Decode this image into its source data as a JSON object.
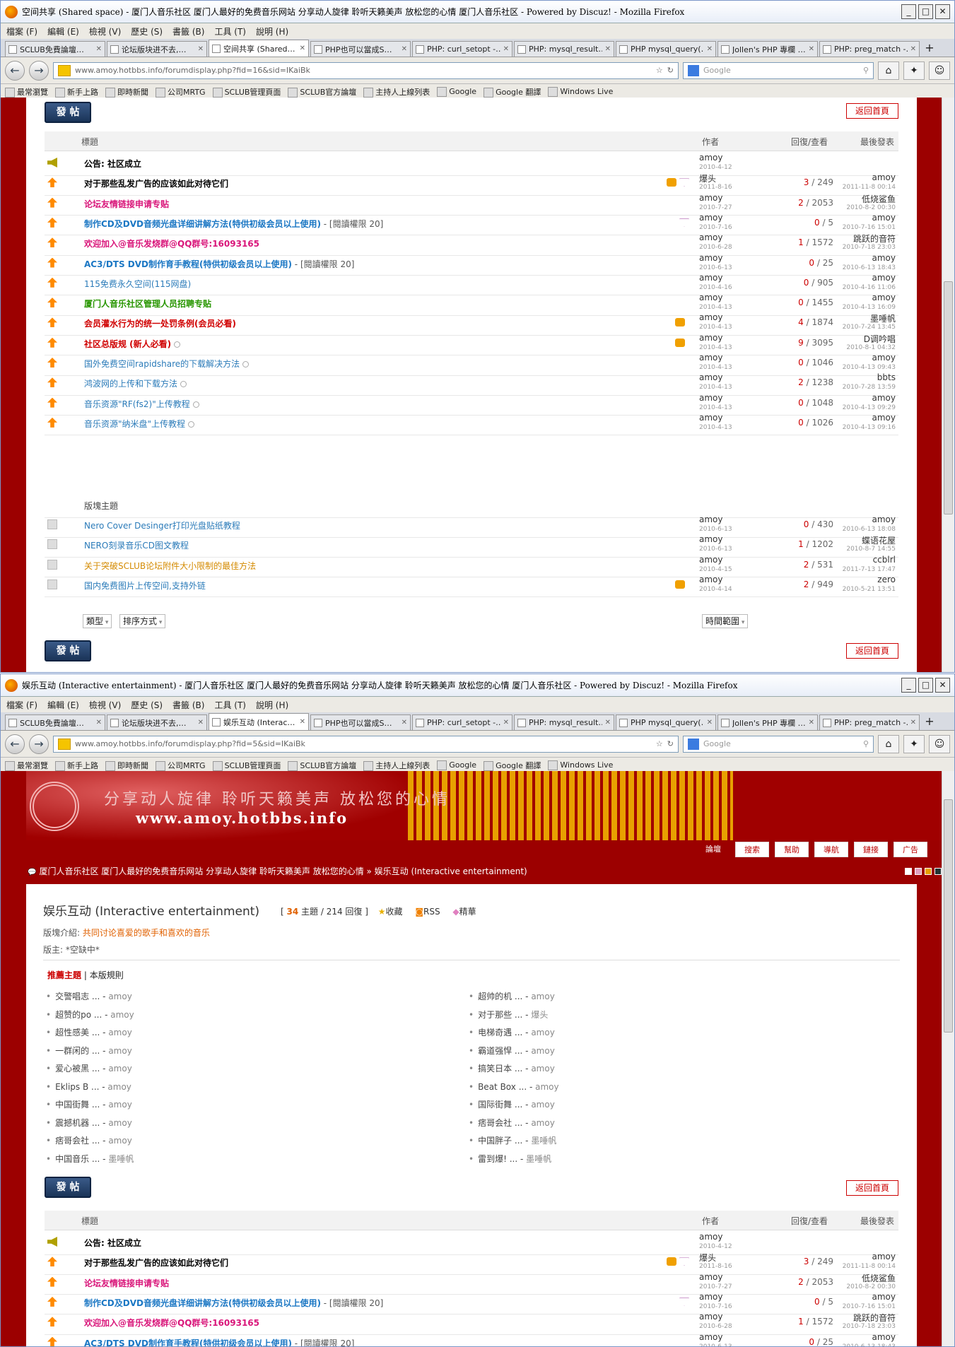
{
  "windows": [
    {
      "title": "空间共享 (Shared space) - 厦门人音乐社区 厦门人最好的免费音乐网站 分享动人旋律 聆听天籁美声 放松您的心情 厦门人音乐社区 - Powered by Discuz! - Mozilla Firefox",
      "url": "www.amoy.hotbbs.info/forumdisplay.php?fid=16&sid=IKaiBk",
      "active_tab": "空间共享 (Shared…"
    },
    {
      "title": "娱乐互动 (Interactive entertainment) - 厦门人音乐社区 厦门人最好的免费音乐网站 分享动人旋律 聆听天籁美声 放松您的心情 厦门人音乐社区 - Powered by Discuz! - Mozilla Firefox",
      "url": "www.amoy.hotbbs.info/forumdisplay.php?fid=5&sid=IKaiBk",
      "active_tab": "娱乐互动 (Interac…"
    }
  ],
  "menu": [
    "檔案 (F)",
    "編輯 (E)",
    "檢視 (V)",
    "歷史 (S)",
    "書籤 (B)",
    "工具 (T)",
    "說明 (H)"
  ],
  "tabs": [
    "SCLUB免費論壇…",
    "论坛版块进不去,…",
    "",
    "PHP也可以當成S…",
    "PHP: curl_setopt -…",
    "PHP: mysql_result…",
    "PHP mysql_query(…",
    "Jollen's PHP 專欄 …",
    "PHP: preg_match -…"
  ],
  "search_placeholder": "Google",
  "bookmarks": [
    "最常瀏覽",
    "新手上路",
    "即時新聞",
    "公司MRTG",
    "SCLUB管理頁面",
    "SCLUB官方論壇",
    "主持人上線列表",
    "Google",
    "Google 翻譯",
    "Windows Live"
  ],
  "buttons": {
    "post": "發 帖",
    "back": "返回首頁"
  },
  "table_header": {
    "title": "標題",
    "author": "作者",
    "replies": "回復/查看",
    "last": "最後發表"
  },
  "section_label": "版塊主題",
  "filters": {
    "type": "類型",
    "sort": "排序方式",
    "time": "時間範圍"
  },
  "threads": [
    {
      "icon": "ann",
      "title": "公告: 社区成立",
      "style": "c-black",
      "author": "amoy",
      "date": "2010-4-12",
      "replies": "",
      "views": "",
      "last_user": "",
      "last_date": ""
    },
    {
      "icon": "hot",
      "title": "对于那些乱发广告的应该如此对待它们",
      "style": "c-black",
      "like": true,
      "dia": true,
      "author": "爆头",
      "date": "2011-8-16",
      "replies": "3",
      "views": "249",
      "last_user": "amoy",
      "last_date": "2011-11-8 00:14"
    },
    {
      "icon": "hot",
      "title": "论坛友情链接申请专贴",
      "style": "c-pink",
      "author": "amoy",
      "date": "2010-7-27",
      "replies": "2",
      "views": "2053",
      "last_user": "低烧鲨鱼",
      "last_date": "2010-8-2 00:30"
    },
    {
      "icon": "hot",
      "title": "制作CD及DVD音频光盘详细讲解方法(特供初级会员以上使用)",
      "perm": " - [閱讀權限 20]",
      "style": "c-blue",
      "dia": true,
      "author": "amoy",
      "date": "2010-7-16",
      "replies": "0",
      "views": "5",
      "last_user": "amoy",
      "last_date": "2010-7-16 15:01"
    },
    {
      "icon": "hot",
      "title": "欢迎加入@音乐发烧群@QQ群号:16093165",
      "style": "c-pink",
      "author": "amoy",
      "date": "2010-6-28",
      "replies": "1",
      "views": "1572",
      "last_user": "跳跃的音符",
      "last_date": "2010-7-18 23:03"
    },
    {
      "icon": "hot",
      "title": "AC3/DTS DVD制作育手教程(特供初级会员以上使用)",
      "perm": " - [閱讀權限 20]",
      "style": "c-blue",
      "author": "amoy",
      "date": "2010-6-13",
      "replies": "0",
      "views": "25",
      "last_user": "amoy",
      "last_date": "2010-6-13 18:43"
    },
    {
      "icon": "hot",
      "title": "115免费永久空间(115网盘)",
      "style": "c-link",
      "author": "amoy",
      "date": "2010-4-16",
      "replies": "0",
      "views": "905",
      "last_user": "amoy",
      "last_date": "2010-4-16 11:06"
    },
    {
      "icon": "hot",
      "title": "厦门人音乐社区管理人员招聘专贴",
      "style": "c-green",
      "author": "amoy",
      "date": "2010-4-13",
      "replies": "0",
      "views": "1455",
      "last_user": "amoy",
      "last_date": "2010-4-13 16:09"
    },
    {
      "icon": "hot",
      "title": "会员灌水行为的统一处罚条例(会员必看)",
      "style": "c-red",
      "like": true,
      "author": "amoy",
      "date": "2010-4-13",
      "replies": "4",
      "views": "1874",
      "last_user": "墨唾帆",
      "last_date": "2010-7-24 13:45"
    },
    {
      "icon": "hot",
      "title": "社区总版规 (新人必看)",
      "style": "c-red",
      "att": true,
      "like": true,
      "author": "amoy",
      "date": "2010-4-13",
      "replies": "9",
      "views": "3095",
      "last_user": "D调吟唱",
      "last_date": "2010-8-1 04:32"
    },
    {
      "icon": "hot",
      "title": "国外免费空间rapidshare的下载解决方法",
      "style": "c-link",
      "att": true,
      "author": "amoy",
      "date": "2010-4-13",
      "replies": "0",
      "views": "1046",
      "last_user": "amoy",
      "last_date": "2010-4-13 09:43"
    },
    {
      "icon": "hot",
      "title": "鸿波网的上传和下载方法",
      "style": "c-link",
      "att": true,
      "author": "amoy",
      "date": "2010-4-13",
      "replies": "2",
      "views": "1238",
      "last_user": "bbts",
      "last_date": "2010-7-28 13:59"
    },
    {
      "icon": "hot",
      "title": "音乐资源\"RF(fs2)\"上传教程",
      "style": "c-link",
      "att": true,
      "author": "amoy",
      "date": "2010-4-13",
      "replies": "0",
      "views": "1048",
      "last_user": "amoy",
      "last_date": "2010-4-13 09:29"
    },
    {
      "icon": "hot",
      "title": "音乐资源\"纳米盘\"上传教程",
      "style": "c-link",
      "att": true,
      "author": "amoy",
      "date": "2010-4-13",
      "replies": "0",
      "views": "1026",
      "last_user": "amoy",
      "last_date": "2010-4-13 09:16"
    }
  ],
  "normal_threads": [
    {
      "icon": "doc",
      "title": "Nero Cover Desinger打印光盘贴纸教程",
      "style": "c-link",
      "author": "amoy",
      "date": "2010-6-13",
      "replies": "0",
      "views": "430",
      "last_user": "amoy",
      "last_date": "2010-6-13 18:08"
    },
    {
      "icon": "doc",
      "title": "NERO刻录音乐CD图文教程",
      "style": "c-link",
      "author": "amoy",
      "date": "2010-6-13",
      "replies": "1",
      "views": "1202",
      "last_user": "蝶语花屋",
      "last_date": "2010-8-7 14:55"
    },
    {
      "icon": "doc",
      "title": "关于突破SCLUB论坛附件大小限制的最佳方法",
      "style": "c-orange",
      "author": "amoy",
      "date": "2010-4-15",
      "replies": "2",
      "views": "531",
      "last_user": "ccblrl",
      "last_date": "2011-7-13 17:47"
    },
    {
      "icon": "doc",
      "title": "国内免费图片上传空间,支持外链",
      "style": "c-link",
      "like": true,
      "author": "amoy",
      "date": "2010-4-14",
      "replies": "2",
      "views": "949",
      "last_user": "zero",
      "last_date": "2010-5-21 13:51"
    }
  ],
  "banner": {
    "slogan": "分享动人旋律  聆听天籁美声  放松您的心情",
    "url": "www.amoy.hotbbs.info"
  },
  "nav": [
    "論壇",
    "搜索",
    "幫助",
    "導航",
    "鏈接",
    "广告"
  ],
  "breadcrumb": "厦门人音乐社区 厦门人最好的免费音乐网站 分享动人旋律 聆听天籁美声 放松您的心情 » 娱乐互动 (Interactive entertainment)",
  "forum": {
    "title": "娱乐互动 (Interactive entertainment)",
    "topics": "34",
    "topics_label": " 主題 / ",
    "replies": "214",
    "replies_label": " 回復 ]",
    "fav": "收藏",
    "rss": "RSS",
    "digest": "精華",
    "intro_label": "版塊介紹: ",
    "intro": "共同讨论喜爱的歌手和喜欢的音乐",
    "mod": "版主: *空缺中*"
  },
  "rec_tabs": {
    "active": "推薦主題",
    "other": "本版規則"
  },
  "recommended_left": [
    {
      "t": "交警唱志 ...",
      "a": "amoy"
    },
    {
      "t": "超赞的po ...",
      "a": "amoy"
    },
    {
      "t": "超性感美 ...",
      "a": "amoy"
    },
    {
      "t": "一群闲的 ...",
      "a": "amoy"
    },
    {
      "t": "爱心被黑 ...",
      "a": "amoy"
    },
    {
      "t": "Eklips B ...",
      "a": "amoy"
    },
    {
      "t": "中国街舞 ...",
      "a": "amoy"
    },
    {
      "t": "震撼机器 ...",
      "a": "amoy"
    },
    {
      "t": "痞哥会社 ...",
      "a": "amoy"
    },
    {
      "t": "中国音乐 ...",
      "a": "墨唾帆"
    }
  ],
  "recommended_right": [
    {
      "t": "超帅的机 ...",
      "a": "amoy"
    },
    {
      "t": "对于那些 ...",
      "a": "爆头"
    },
    {
      "t": "电梯奇遇 ...",
      "a": "amoy"
    },
    {
      "t": "霸道强悍 ...",
      "a": "amoy"
    },
    {
      "t": "搞笑日本 ...",
      "a": "amoy"
    },
    {
      "t": "Beat Box ...",
      "a": "amoy"
    },
    {
      "t": "国际街舞 ...",
      "a": "amoy"
    },
    {
      "t": "痞哥会社 ...",
      "a": "amoy"
    },
    {
      "t": "中国胖子 ...",
      "a": "墨唾帆"
    },
    {
      "t": "雷到爆! ...",
      "a": "墨唾帆"
    }
  ],
  "colors": {
    "bg_red": "#9c0000",
    "link": "#2b7bb9",
    "hot": "#ff8a00"
  }
}
